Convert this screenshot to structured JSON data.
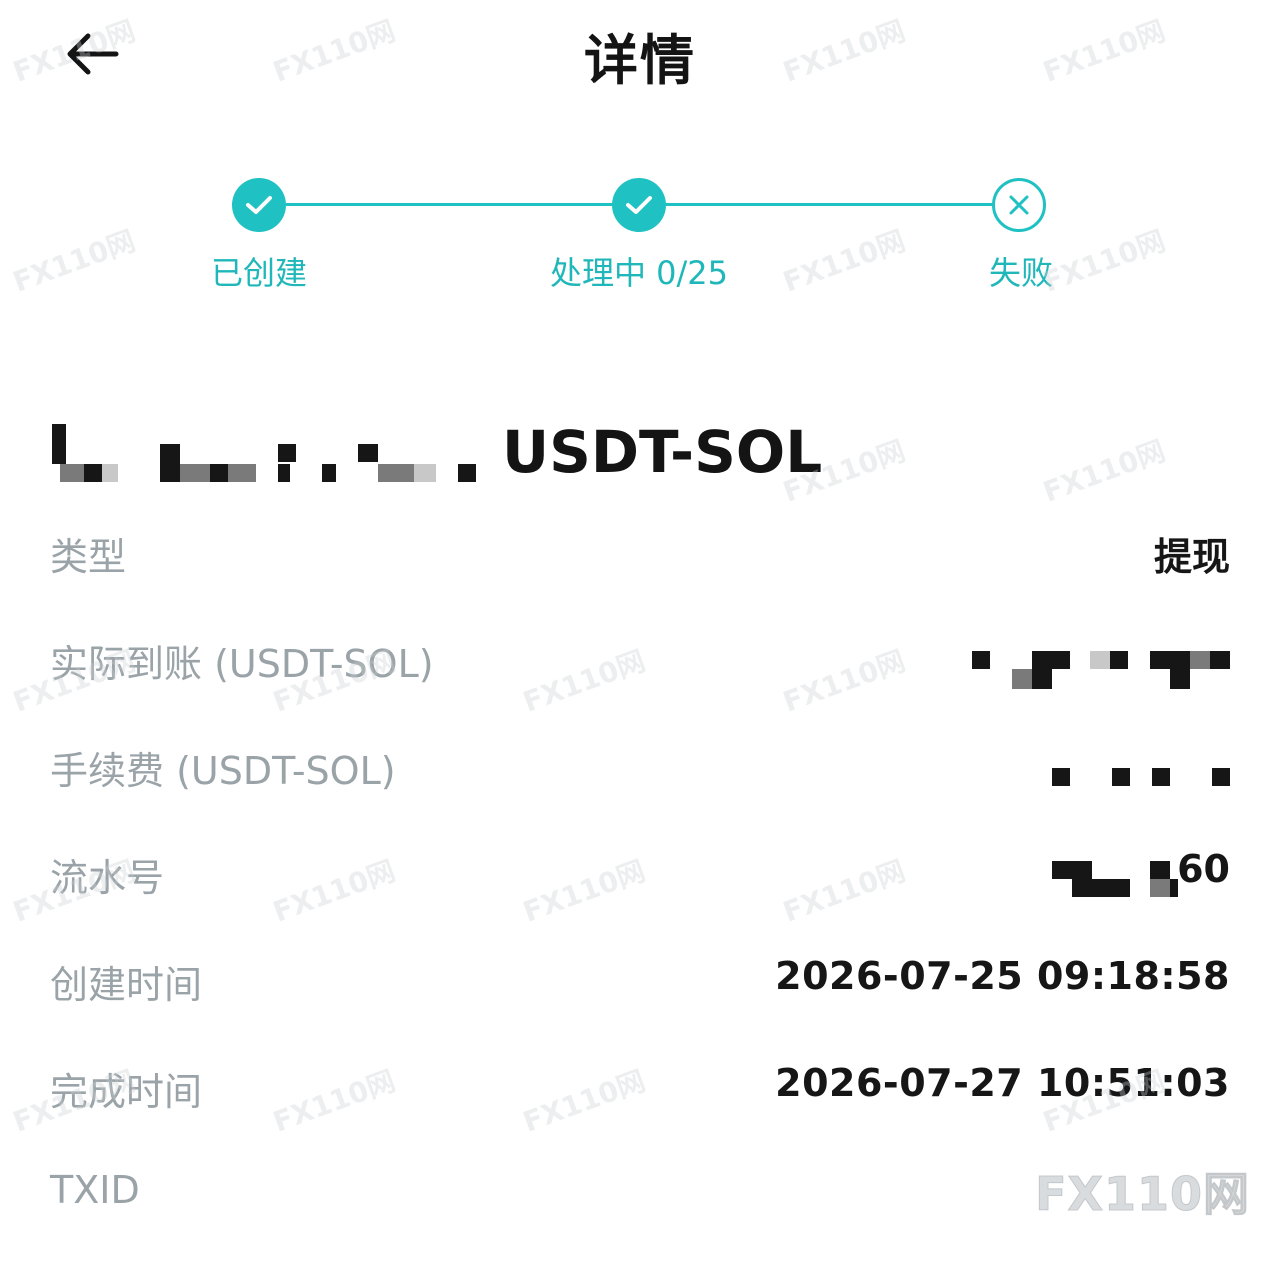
{
  "header": {
    "title": "详情",
    "back_icon": "arrow-left-icon"
  },
  "progress": {
    "accent_color": "#1fc1c3",
    "steps": [
      {
        "label": "已创建",
        "state": "done"
      },
      {
        "label": "处理中 0/25",
        "state": "done"
      },
      {
        "label": "失败",
        "state": "failed"
      }
    ]
  },
  "amount": {
    "unit": "USDT-SOL"
  },
  "details": [
    {
      "label": "类型",
      "value": "提现"
    },
    {
      "label": "实际到账 (USDT-SOL)",
      "value": ""
    },
    {
      "label": "手续费 (USDT-SOL)",
      "value": ""
    },
    {
      "label": "流水号",
      "value": "60"
    },
    {
      "label": "创建时间",
      "value": "2026-07-25 09:18:58"
    },
    {
      "label": "完成时间",
      "value": "2026-07-27 10:51:03"
    },
    {
      "label": "TXID",
      "value": ""
    }
  ],
  "watermark": {
    "text": "FX110网"
  }
}
